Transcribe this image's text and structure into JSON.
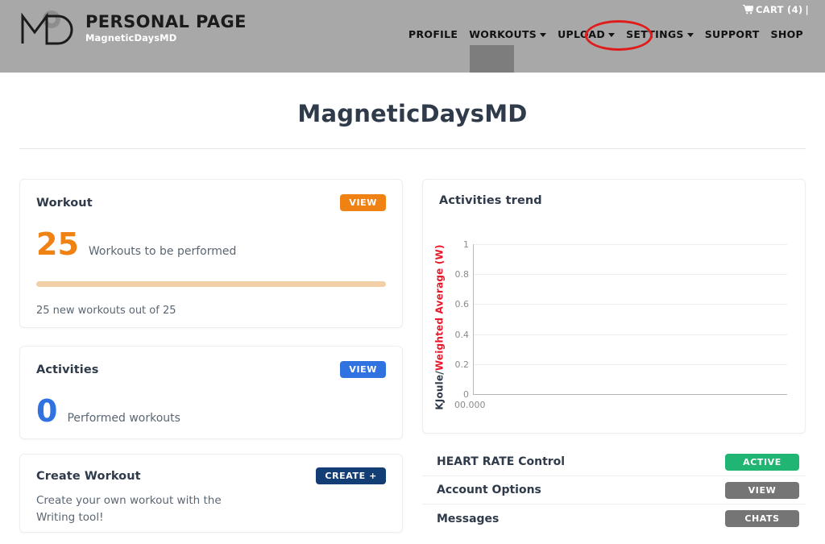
{
  "header": {
    "logo": {
      "icon": "md-monogram-logo",
      "title": "PERSONAL PAGE",
      "subtitle": "MagneticDaysMD"
    },
    "cart": {
      "icon": "shopping-cart-icon",
      "label": "CART (4)",
      "separator": "|"
    },
    "nav": [
      {
        "label": "PROFILE",
        "has_caret": false
      },
      {
        "label": "WORKOUTS",
        "has_caret": true
      },
      {
        "label": "UPLOAD",
        "has_caret": true
      },
      {
        "label": "SETTINGS",
        "has_caret": true
      },
      {
        "label": "SUPPORT",
        "has_caret": false
      },
      {
        "label": "SHOP",
        "has_caret": false
      }
    ],
    "annotation_color": "#e01b1b",
    "bar_color": "#a8a8a8"
  },
  "page_title": "MagneticDaysMD",
  "workout_card": {
    "title": "Workout",
    "view_label": "VIEW",
    "count": "25",
    "count_label": "Workouts to be performed",
    "progress_text": "25 new workouts out of 25",
    "progress_percent": 100,
    "accent": "#f08113"
  },
  "activities_card": {
    "title": "Activities",
    "view_label": "VIEW",
    "count": "0",
    "count_label": "Performed workouts",
    "accent": "#2f72e0"
  },
  "create_card": {
    "title": "Create Workout",
    "create_label": "CREATE +",
    "line1": "Create your own workout with the",
    "line2": "Writing tool!",
    "accent": "#123d75"
  },
  "trend_card": {
    "title": "Activities trend"
  },
  "chart_data": {
    "type": "line",
    "title": "Activities trend",
    "series": [
      {
        "name": "KJoule/Weighted Average (W)",
        "values": []
      }
    ],
    "x": [],
    "xlabel": "",
    "ylabel_part1": "KJoule/",
    "ylabel_part2": "Weighted Average (W)",
    "ylabel_part1_color": "#2f3b4a",
    "ylabel_part2_color": "#e8192c",
    "yticks": [
      "1",
      "0.8",
      "0.6",
      "0.4",
      "0.2",
      "0"
    ],
    "ylim": [
      0,
      1
    ],
    "xticks": [
      "00.000"
    ],
    "grid": true,
    "legend": "none",
    "empty": true
  },
  "list_rows": [
    {
      "label": "HEART RATE Control",
      "action": "ACTIVE",
      "style": "green"
    },
    {
      "label": "Account Options",
      "action": "VIEW",
      "style": "gray"
    },
    {
      "label": "Messages",
      "action": "CHATS",
      "style": "gray"
    }
  ]
}
